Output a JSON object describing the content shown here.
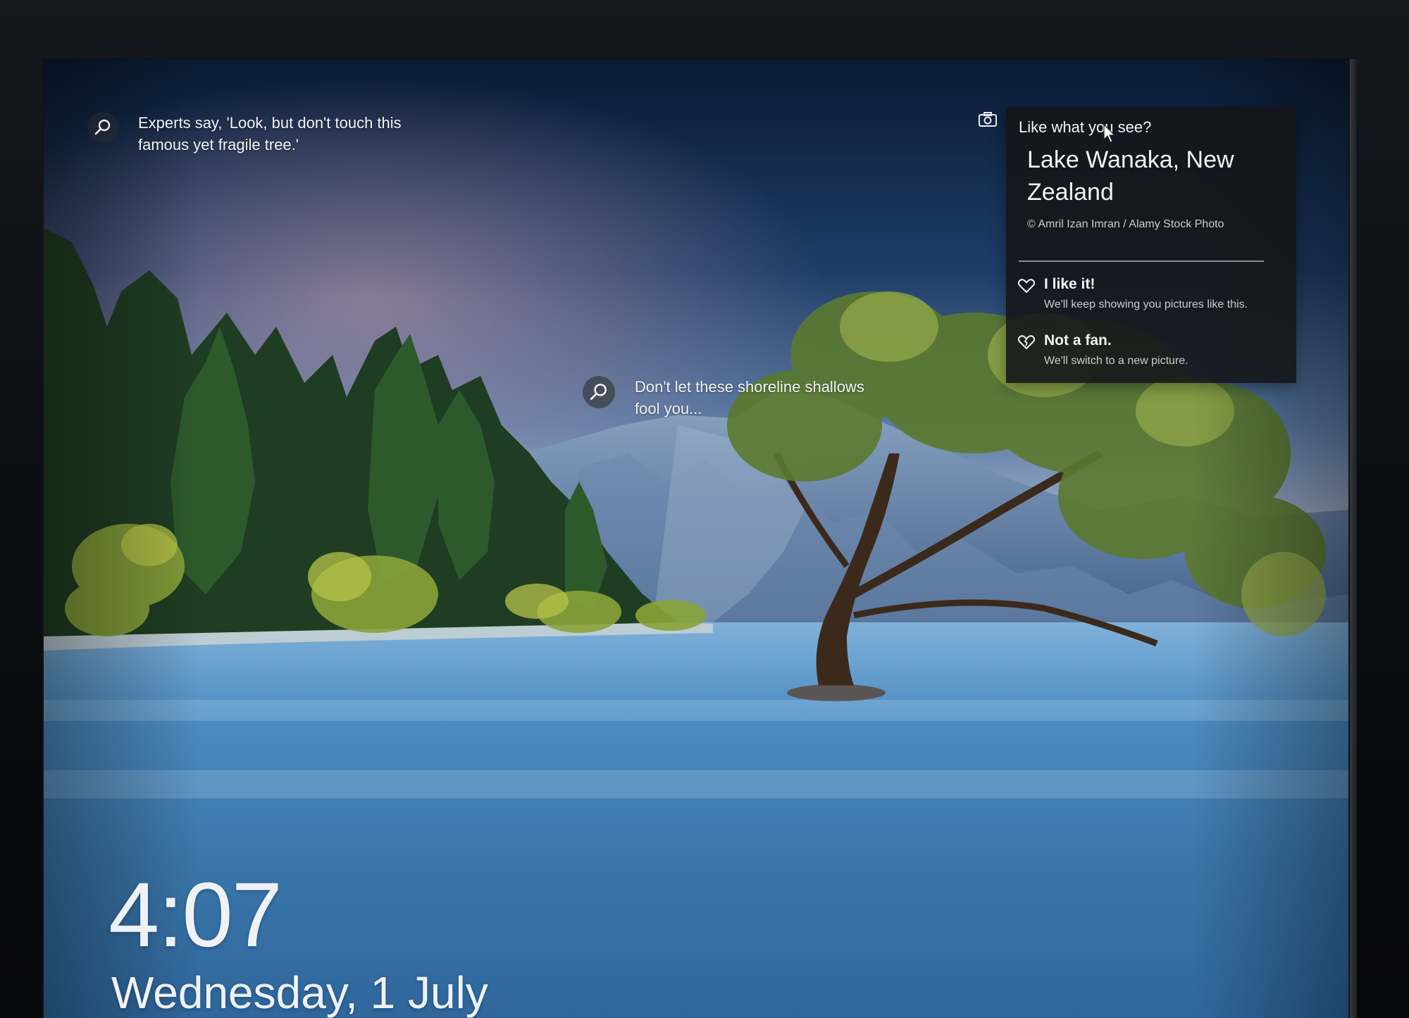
{
  "lock_screen": {
    "time": "4:07",
    "date": "Wednesday, 1 July"
  },
  "spotlight": {
    "hotspot_1": {
      "text": "Experts say, 'Look, but don't touch this famous yet fragile tree.'"
    },
    "hotspot_2": {
      "text": "Don't let these shoreline shallows fool you..."
    }
  },
  "flyout": {
    "question": "Like what you see?",
    "title": "Lake Wanaka, New Zealand",
    "credit": "© Amril Izan Imran / Alamy Stock Photo",
    "options": [
      {
        "label": "I like it!",
        "description": "We'll keep showing you pictures like this."
      },
      {
        "label": "Not a fan.",
        "description": "We'll switch to a new picture."
      }
    ]
  },
  "icons": {
    "hotspot": "search-icon",
    "camera": "camera-icon",
    "like": "heart-icon",
    "dislike": "broken-heart-icon",
    "cursor": "mouse-pointer-icon"
  },
  "colors": {
    "flyout_bg": "#16181c",
    "text": "#f3f3f3",
    "sky_top": "#0b1e3a",
    "lake": "#3e7fb5"
  }
}
